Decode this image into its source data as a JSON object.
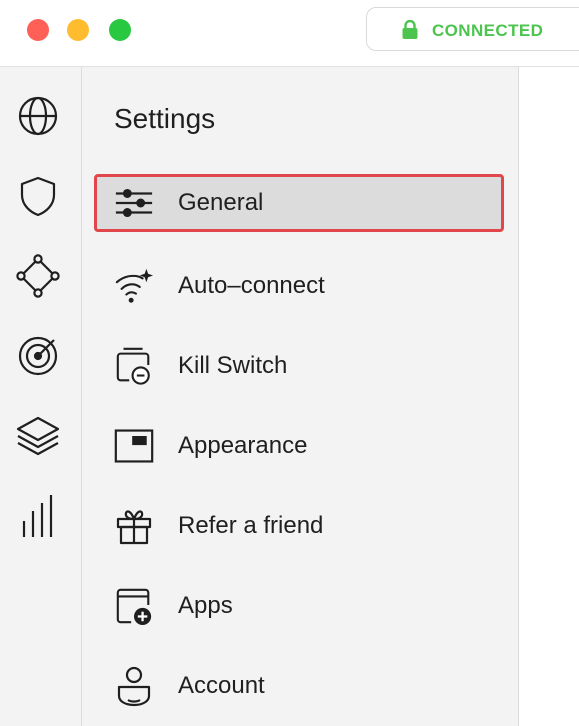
{
  "window": {
    "controls": [
      "close",
      "minimize",
      "zoom"
    ],
    "status": {
      "text": "CONNECTED",
      "icon": "lock-icon",
      "color": "#4cc44e"
    }
  },
  "rail": {
    "items": [
      {
        "icon": "globe-icon"
      },
      {
        "icon": "shield-icon"
      },
      {
        "icon": "nodes-icon"
      },
      {
        "icon": "target-icon"
      },
      {
        "icon": "layers-icon"
      },
      {
        "icon": "bar-chart-icon"
      }
    ]
  },
  "settings": {
    "title": "Settings",
    "items": [
      {
        "label": "General",
        "icon": "sliders-icon",
        "selected": true
      },
      {
        "label": "Auto–connect",
        "icon": "wifi-sparkle-icon",
        "selected": false
      },
      {
        "label": "Kill Switch",
        "icon": "kill-switch-icon",
        "selected": false
      },
      {
        "label": "Appearance",
        "icon": "appearance-icon",
        "selected": false
      },
      {
        "label": "Refer a friend",
        "icon": "gift-icon",
        "selected": false
      },
      {
        "label": "Apps",
        "icon": "apps-add-icon",
        "selected": false
      },
      {
        "label": "Account",
        "icon": "account-icon",
        "selected": false
      }
    ]
  },
  "colors": {
    "accent_connected": "#4cc44e",
    "selection_border": "#e0464a",
    "selection_bg": "#dcdcdc",
    "sidebar_bg": "#f3f3f3"
  }
}
